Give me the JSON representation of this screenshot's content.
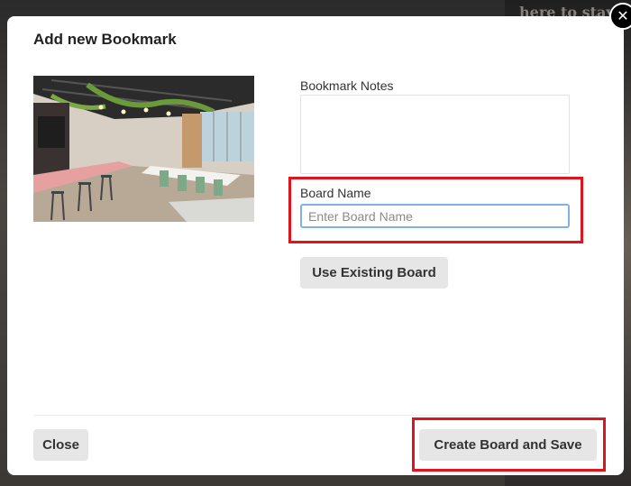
{
  "background": {
    "headline": "here to stay"
  },
  "modal": {
    "title": "Add new Bookmark",
    "close_icon": "close-x-icon",
    "image_alt": "office interior with long tables, green chairs and hanging plants"
  },
  "form": {
    "notes_label": "Bookmark Notes",
    "notes_value": "",
    "board_name_label": "Board Name",
    "board_name_value": "",
    "board_name_placeholder": "Enter Board Name",
    "use_existing_label": "Use Existing Board"
  },
  "footer": {
    "close_label": "Close",
    "create_label": "Create Board and Save"
  },
  "colors": {
    "highlight": "#e0141b",
    "input_focus": "#7fb0e6",
    "button_bg": "#e6e6e6"
  }
}
